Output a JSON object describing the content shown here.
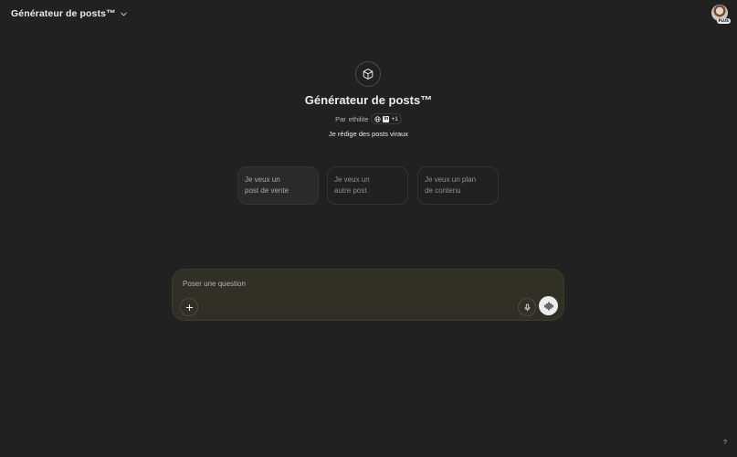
{
  "header": {
    "model_selector": {
      "label": "Générateur de posts™",
      "icon": "chevron-down-icon"
    },
    "avatar": {
      "badge": "PLUS"
    }
  },
  "gpt": {
    "icon": "cube-icon",
    "title": "Générateur de posts™",
    "author_prefix": "Par",
    "author": "ethilite",
    "badges": {
      "web": "globe-icon",
      "linkedin": "in",
      "extra": "+1"
    },
    "description": "Je rédige des posts viraux"
  },
  "starters": [
    {
      "line1": "Je veux un",
      "line2": "post de vente"
    },
    {
      "line1": "Je veux un",
      "line2": "autre post"
    },
    {
      "line1": "Je veux un plan",
      "line2": "de contenu"
    }
  ],
  "composer": {
    "placeholder": "Poser une question",
    "value": "",
    "plus_icon": "plus-icon",
    "mic_icon": "microphone-icon",
    "voice_icon": "voice-mode-icon"
  },
  "help": {
    "label": "?"
  },
  "colors": {
    "background": "#212121",
    "composer": "#303026",
    "text": "#ececec",
    "muted": "#8f8f8f"
  }
}
